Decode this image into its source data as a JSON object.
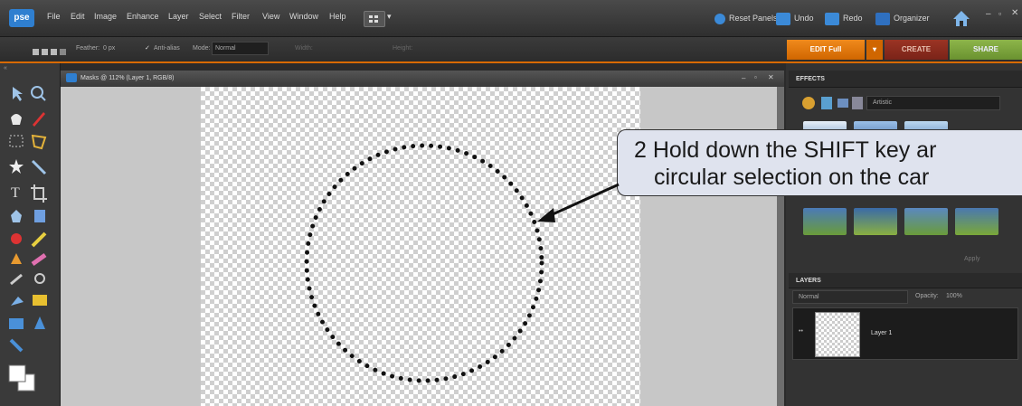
{
  "menubar": {
    "logo": "pse",
    "items": [
      "File",
      "Edit",
      "Image",
      "Enhance",
      "Layer",
      "Select",
      "Filter",
      "View",
      "Window",
      "Help"
    ],
    "reset_panels": "Reset Panels",
    "undo": "Undo",
    "redo": "Redo",
    "organizer": "Organizer"
  },
  "options_bar": {
    "feather_label": "Feather:",
    "feather_value": "0 px",
    "antialias_label": "Anti-alias",
    "mode_label": "Mode:",
    "mode_value": "Normal",
    "width_label": "Width:",
    "height_label": "Height:"
  },
  "tabs": {
    "edit_full": "EDIT Full",
    "create": "CREATE",
    "share": "SHARE"
  },
  "document": {
    "title": "Masks @ 112% (Layer 1, RGB/8)"
  },
  "effects_panel": {
    "header": "EFFECTS",
    "category": "Artistic",
    "apply": "Apply"
  },
  "layers_panel": {
    "header": "LAYERS",
    "blend_mode": "Normal",
    "opacity_label": "Opacity:",
    "opacity_value": "100%",
    "layer_name": "Layer 1"
  },
  "callout": {
    "line1": "2  Hold down the SHIFT key ar",
    "line2": "circular selection on the car"
  },
  "colors": {
    "accent_orange": "#d86a00",
    "share_green": "#7ea63a",
    "create_red": "#8a2b1f"
  }
}
